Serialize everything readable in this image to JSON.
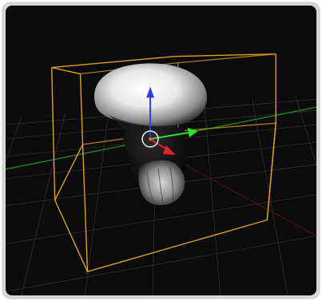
{
  "viewport": {
    "background_color": "#0b0b0b",
    "grid_color": "#3a3a3a",
    "bbox_color": "#e0a020",
    "axis_colors": {
      "x": "#e0242b",
      "y": "#2ee32e",
      "z": "#2a3fe8"
    },
    "object": "mushroom-volume"
  }
}
